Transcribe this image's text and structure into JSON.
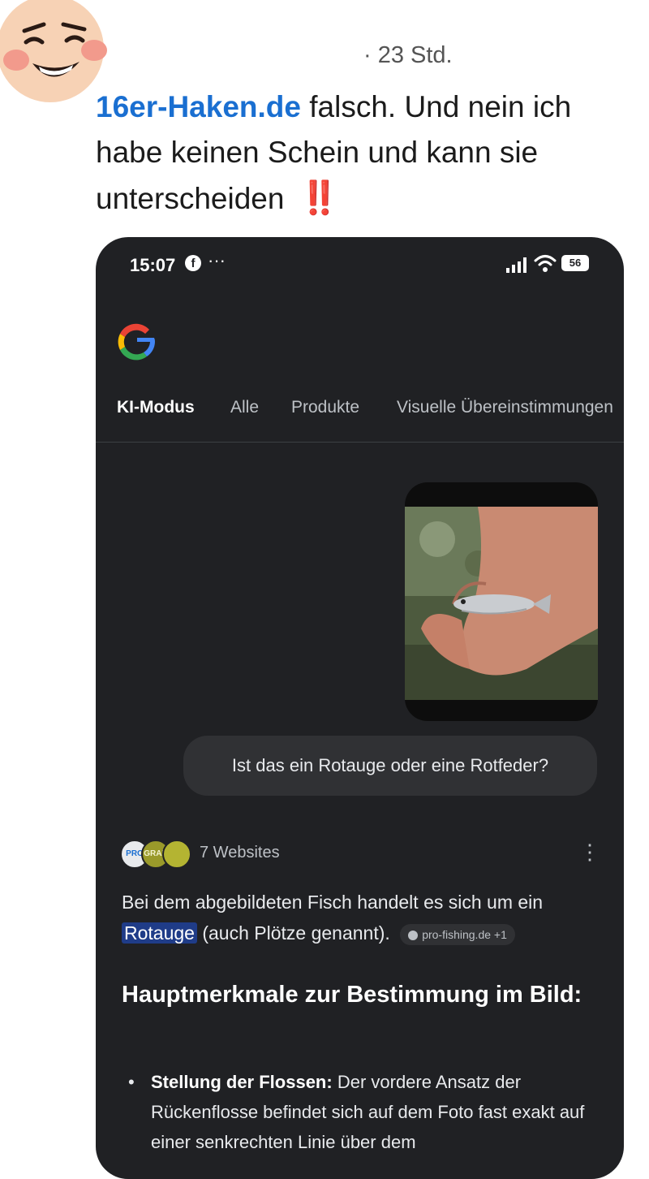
{
  "post": {
    "time": "· 23 Std.",
    "mention": "16er-Haken.de",
    "text_line": "falsch. Und nein ich habe keinen Schein und kann sie unterscheiden",
    "emoji": "‼️"
  },
  "phone": {
    "status": {
      "time": "15:07",
      "fb_icon": "f",
      "dots": "···",
      "battery": "56"
    },
    "tabs": [
      {
        "label": "KI-Modus"
      },
      {
        "label": "Alle"
      },
      {
        "label": "Produkte"
      },
      {
        "label": "Visuelle Übereinstimmungen"
      }
    ],
    "query": "Ist das ein Rotauge oder eine Rotfeder?",
    "sources": {
      "label": "7 Websites",
      "avatars": [
        "PRO",
        "GRAR",
        ""
      ]
    },
    "answer": {
      "before": "Bei dem abgebildeten Fisch handelt es sich um ein",
      "highlight": "Rotauge",
      "after": "(auch Plötze genannt).",
      "chip": "pro-fishing.de +1"
    },
    "heading": "Hauptmerkmale zur Bestimmung im Bild:",
    "bullet": {
      "title": "Stellung der Flossen:",
      "text": "Der vordere Ansatz der Rückenflosse befindet sich auf dem Foto fast exakt auf einer senkrechten Linie über dem"
    }
  },
  "colors": {
    "mention": "#1a6fd1",
    "phone_bg": "#202124",
    "highlight": "#1f3c88"
  }
}
